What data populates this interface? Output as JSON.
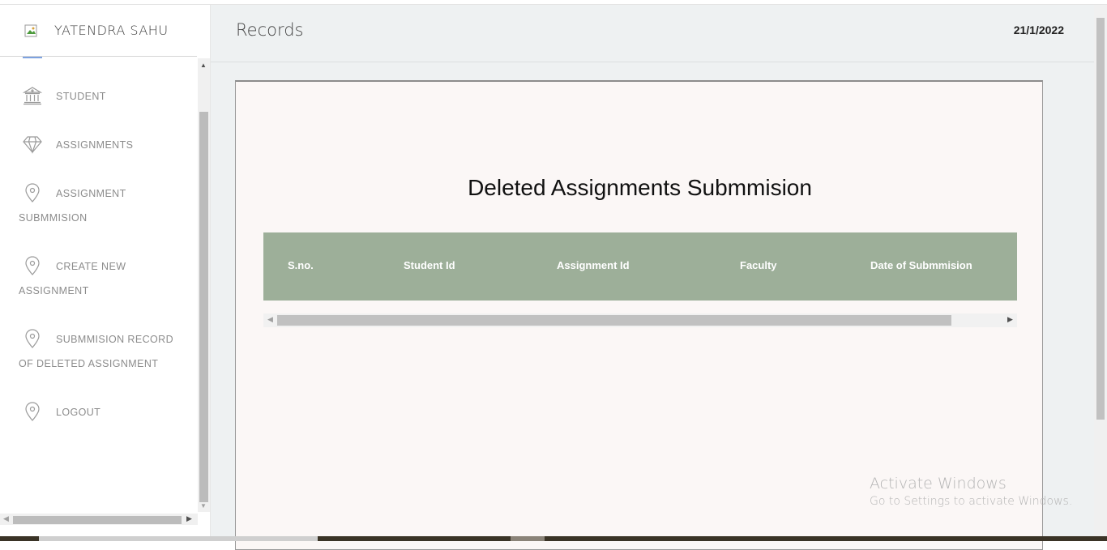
{
  "brand": {
    "name": "YATENDRA SAHU"
  },
  "sidebar": {
    "items": [
      {
        "label_line1": "STUDENT",
        "label_line2": "",
        "icon": "bank-icon"
      },
      {
        "label_line1": "ASSIGNMENTS",
        "label_line2": "",
        "icon": "diamond-icon"
      },
      {
        "label_line1": "ASSIGNMENT",
        "label_line2": "SUBMMISION",
        "icon": "location-pin-icon"
      },
      {
        "label_line1": "CREATE NEW",
        "label_line2": "ASSIGNMENT",
        "icon": "location-pin-icon"
      },
      {
        "label_line1": "SUBMMISION RECORD",
        "label_line2": "OF DELETED ASSIGNMENT",
        "icon": "location-pin-icon"
      },
      {
        "label_line1": "LOGOUT",
        "label_line2": "",
        "icon": "location-pin-icon"
      }
    ]
  },
  "header": {
    "title": "Records",
    "date": "21/1/2022"
  },
  "card": {
    "title": "Deleted Assignments Submmision",
    "columns": [
      "S.no.",
      "Student Id",
      "Assignment Id",
      "Faculty",
      "Date of Submmision"
    ]
  },
  "watermark": {
    "line1": "Activate Windows",
    "line2": "Go to Settings to activate Windows."
  },
  "colors": {
    "table_header": "#9daf99",
    "card_bg": "#fbf7f6",
    "main_bg": "#eef1f2"
  }
}
